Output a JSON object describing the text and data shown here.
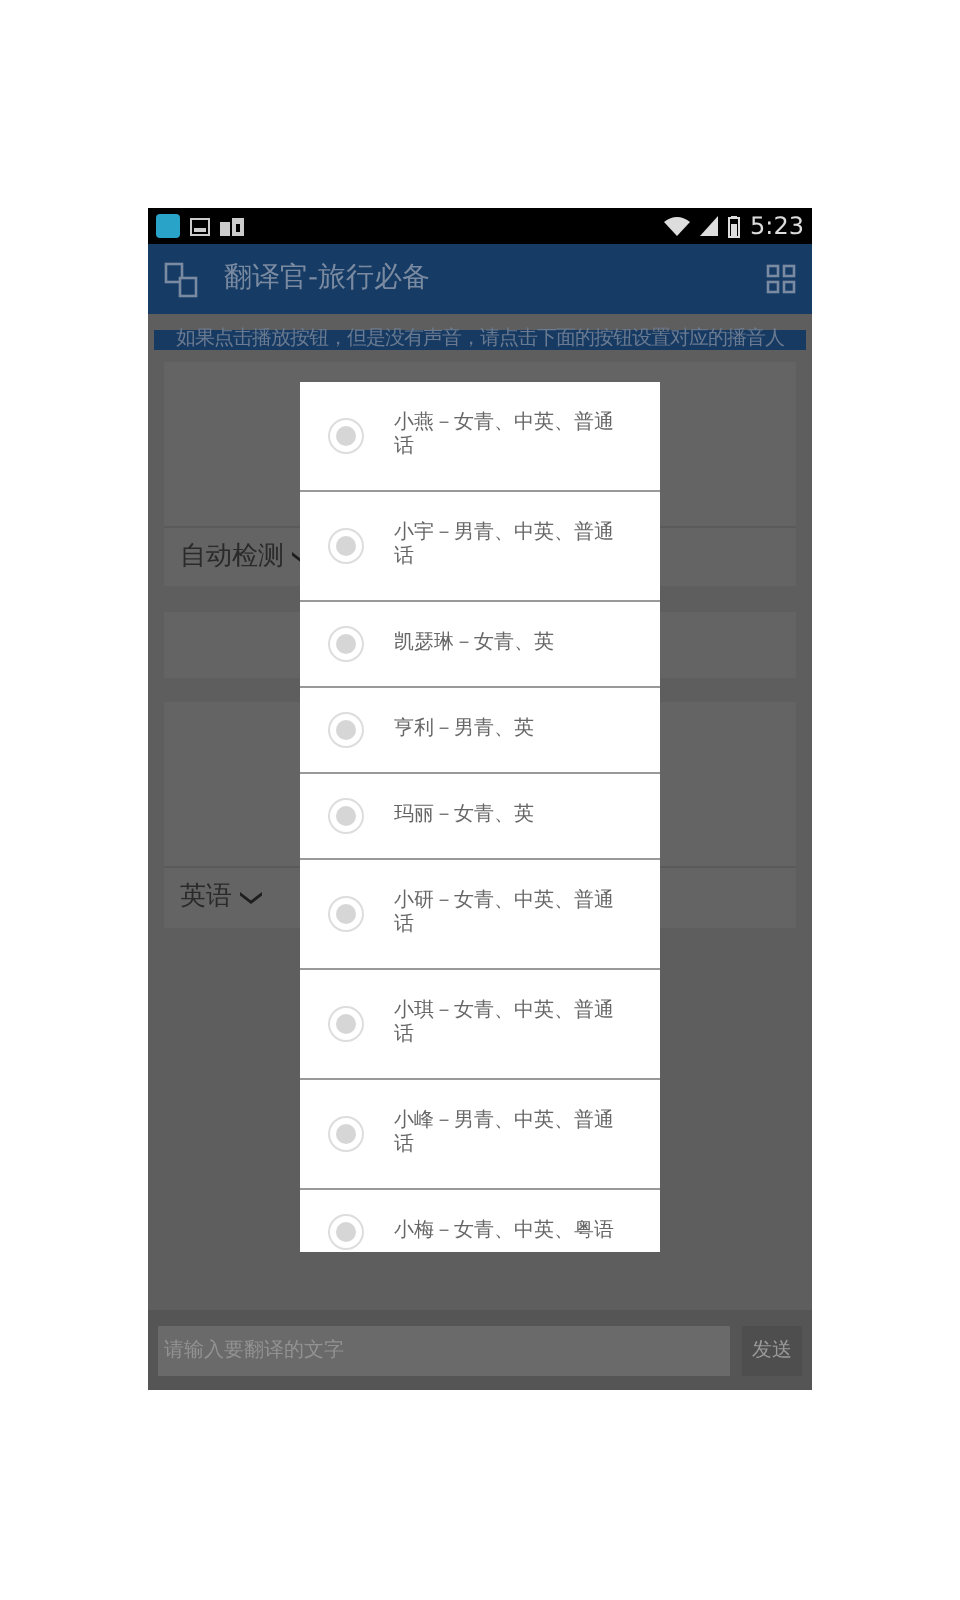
{
  "status_bar": {
    "time": "5:23"
  },
  "app_bar": {
    "title": "翻译官-旅行必备"
  },
  "notice": "如果点击播放按钮，但是没有声音，请点击下面的按钮设置对应的播音人",
  "source_language": "自动检测",
  "target_language": "英语",
  "input": {
    "placeholder": "请输入要翻译的文字"
  },
  "send_button": "发送",
  "voice_dialog": {
    "options": [
      {
        "label": "小燕－女青、中英、普通话",
        "selected": false
      },
      {
        "label": "小宇－男青、中英、普通话",
        "selected": false
      },
      {
        "label": "凯瑟琳－女青、英",
        "selected": false
      },
      {
        "label": "亨利－男青、英",
        "selected": false
      },
      {
        "label": "玛丽－女青、英",
        "selected": false
      },
      {
        "label": "小研－女青、中英、普通话",
        "selected": false
      },
      {
        "label": "小琪－女青、中英、普通话",
        "selected": false
      },
      {
        "label": "小峰－男青、中英、普通话",
        "selected": false
      },
      {
        "label": "小梅－女青、中英、粤语",
        "selected": false
      }
    ]
  }
}
